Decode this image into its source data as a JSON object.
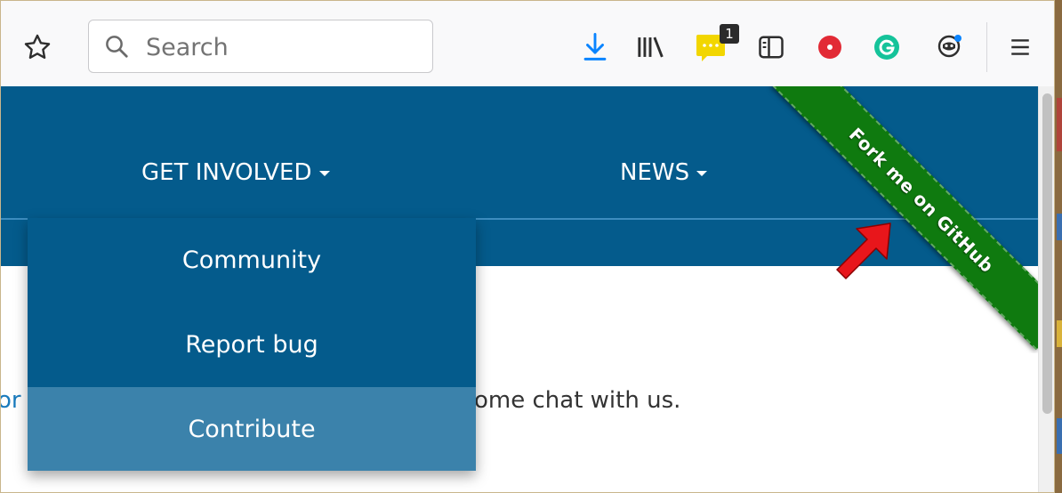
{
  "toolbar": {
    "search": {
      "placeholder": "Search",
      "value": ""
    },
    "extension_badge_count": "1",
    "icons": {
      "bookmark": "star-icon",
      "search": "search-icon",
      "download": "download-arrow-icon",
      "library": "library-icon",
      "chat_extension": "chat-bubble-icon",
      "sidebar": "sidebar-icon",
      "red_extension": "record-dot-icon",
      "grammarly": "grammarly-icon",
      "privacy": "privacy-badger-icon",
      "menu": "hamburger-menu-icon"
    },
    "colors": {
      "download": "#0a84ff",
      "chat_extension": "#f2d600",
      "red_extension": "#e22a35",
      "grammarly": "#15c39a"
    }
  },
  "navbar": {
    "items": [
      {
        "label": "GET INVOLVED",
        "has_dropdown": true
      },
      {
        "label": "NEWS",
        "has_dropdown": true
      }
    ],
    "background": "#045b8c"
  },
  "dropdown": {
    "items": [
      {
        "label": "Community",
        "highlighted": false
      },
      {
        "label": "Report bug",
        "highlighted": false
      },
      {
        "label": "Contribute",
        "highlighted": true
      }
    ],
    "highlight_color": "#3b82ab"
  },
  "ribbon": {
    "label": "Fork me on GitHub",
    "color": "#0f7a0f"
  },
  "page": {
    "text_partial": "ome chat with us.",
    "text_left_fragment": "or"
  },
  "annotation": {
    "color": "#e8161b"
  }
}
